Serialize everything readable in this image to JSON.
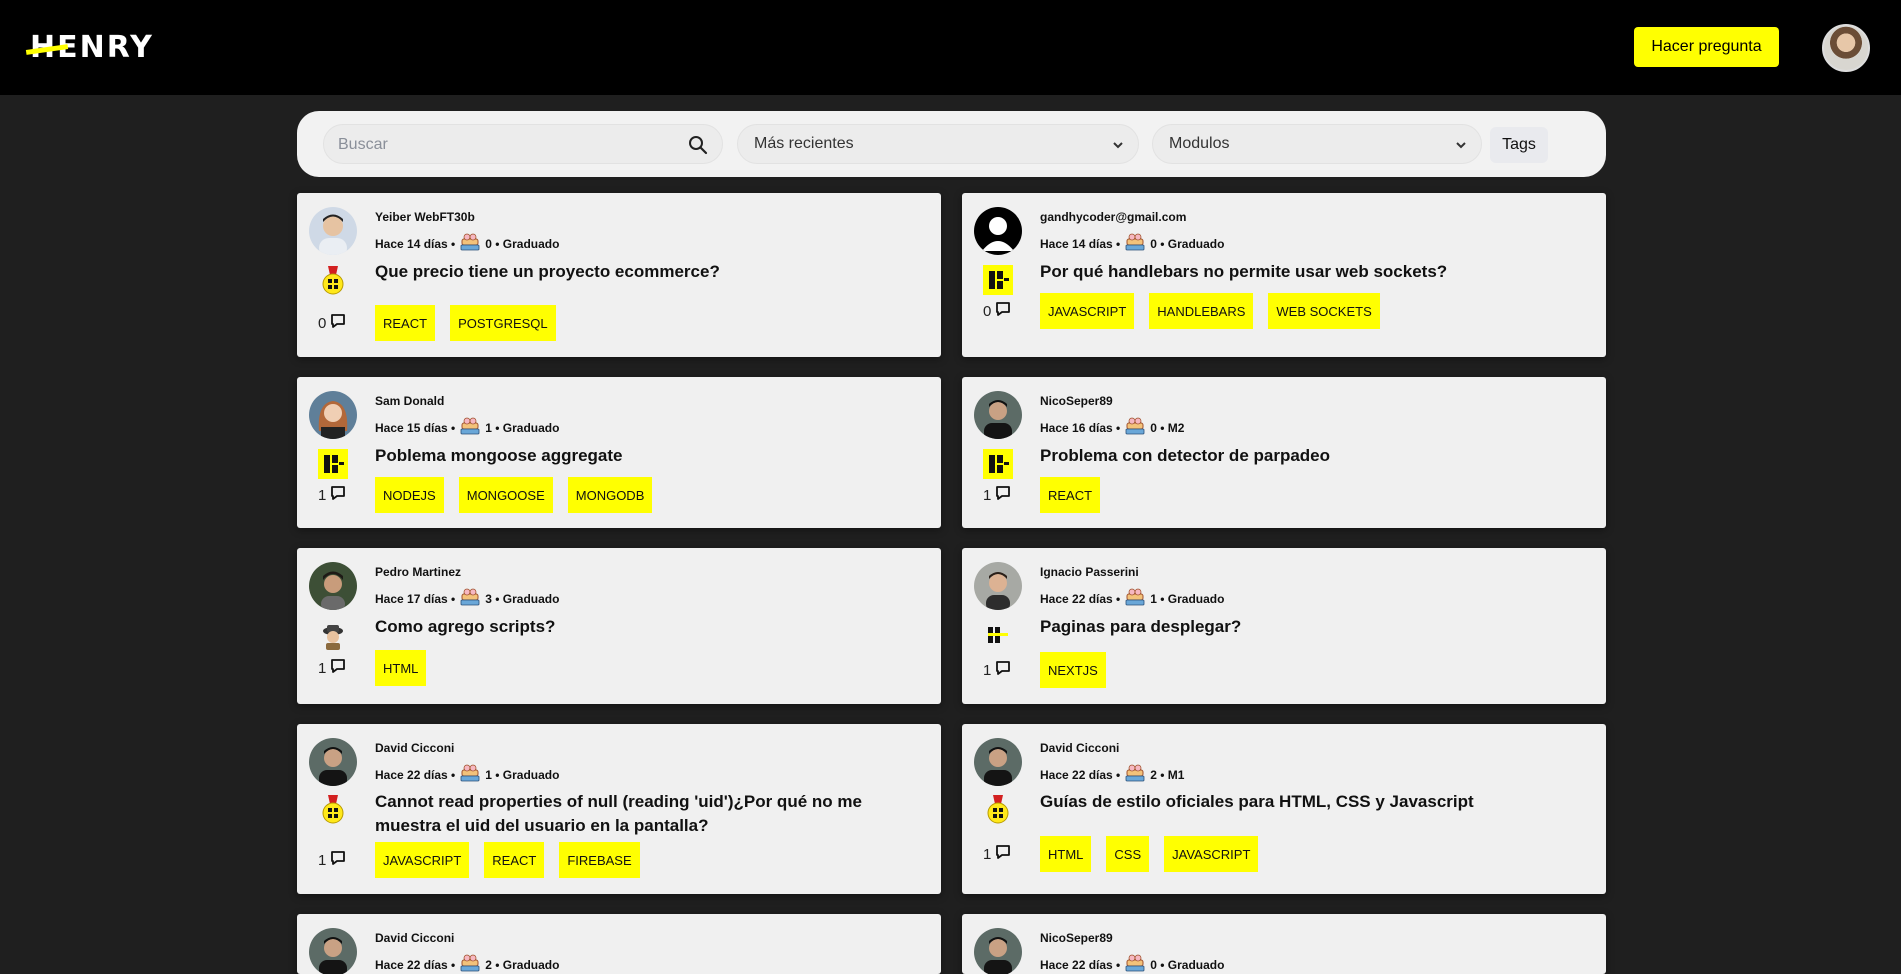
{
  "brand": {
    "logo_text": "HENRY",
    "accent": "#ffff01"
  },
  "header": {
    "ask_label": "Hacer pregunta"
  },
  "filters": {
    "search_placeholder": "Buscar",
    "sort_selected": "Más recientes",
    "module_selected": "Modulos",
    "tags_label": "Tags"
  },
  "posts": [
    {
      "user": "Yeiber WebFT30b",
      "when": "Hace 14 días •",
      "points": "0 • Graduado",
      "title": "Que precio tiene un proyecto ecommerce?",
      "comments": "0",
      "tags": [
        "REACT",
        "POSTGRESQL"
      ],
      "badge": "medal-icon",
      "avatar": "avatar-blue-icon"
    },
    {
      "user": "gandhycoder@gmail.com",
      "when": "Hace 14 días •",
      "points": "0 • Graduado",
      "title": "Por qué handlebars no permite usar web sockets?",
      "comments": "0",
      "tags": [
        "JAVASCRIPT",
        "HANDLEBARS",
        "WEB SOCKETS"
      ],
      "badge": "henry-badge-icon",
      "avatar": "default-user-icon"
    },
    {
      "user": "Sam Donald",
      "when": "Hace 15 días •",
      "points": "1 • Graduado",
      "title": "Poblema mongoose aggregate",
      "comments": "1",
      "tags": [
        "NODEJS",
        "MONGOOSE",
        "MONGODB"
      ],
      "badge": "henry-badge-icon",
      "avatar": "avatar-woman-icon"
    },
    {
      "user": "NicoSeper89",
      "when": "Hace 16 días •",
      "points": "0 • M2",
      "title": "Problema con detector de parpadeo",
      "comments": "1",
      "tags": [
        "REACT"
      ],
      "badge": "henry-badge-icon",
      "avatar": "avatar-dark-icon"
    },
    {
      "user": "Pedro Martinez",
      "when": "Hace 17 días •",
      "points": "3 • Graduado",
      "title": "Como agrego scripts?",
      "comments": "1",
      "tags": [
        "HTML"
      ],
      "badge": "detective-icon",
      "avatar": "avatar-green-icon"
    },
    {
      "user": "Ignacio Passerini",
      "when": "Hace 22 días •",
      "points": "1 • Graduado",
      "title": "Paginas para desplegar?",
      "comments": "1",
      "tags": [
        "NEXTJS"
      ],
      "badge": "henry-small-icon",
      "avatar": "avatar-light-icon"
    },
    {
      "user": "David Cicconi",
      "when": "Hace 22 días •",
      "points": "1 • Graduado",
      "title": "Cannot read properties of null (reading 'uid')¿Por qué no me muestra el uid del usuario en la pantalla?",
      "comments": "1",
      "tags": [
        "JAVASCRIPT",
        "REACT",
        "FIREBASE"
      ],
      "badge": "medal-icon",
      "avatar": "avatar-dark-icon"
    },
    {
      "user": "David Cicconi",
      "when": "Hace 22 días •",
      "points": "2 • M1",
      "title": "Guías de estilo oficiales para HTML, CSS y Javascript",
      "comments": "1",
      "tags": [
        "HTML",
        "CSS",
        "JAVASCRIPT"
      ],
      "badge": "medal-icon",
      "avatar": "avatar-dark-icon"
    },
    {
      "user": "David Cicconi",
      "when": "Hace 22 días •",
      "points": "2 • Graduado",
      "title": "",
      "comments": "",
      "tags": [],
      "badge": "",
      "avatar": "avatar-dark-icon"
    },
    {
      "user": "NicoSeper89",
      "when": "Hace 22 días •",
      "points": "0 • Graduado",
      "title": "",
      "comments": "",
      "tags": [],
      "badge": "",
      "avatar": "avatar-dark-icon"
    }
  ]
}
